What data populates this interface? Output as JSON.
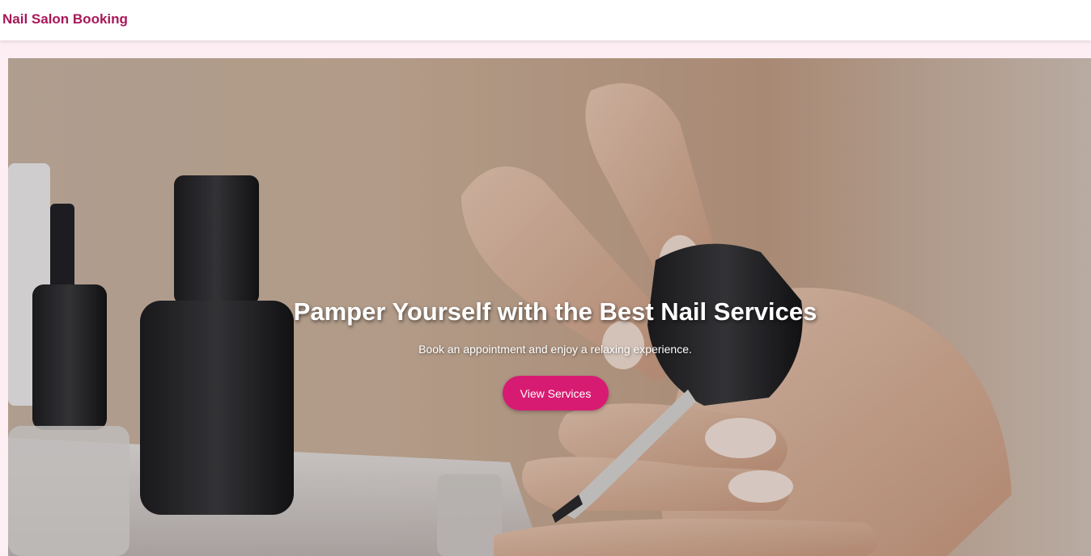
{
  "header": {
    "brand": "Nail Salon Booking"
  },
  "hero": {
    "title": "Pamper Yourself with the Best Nail Services",
    "subtitle": "Book an appointment and enjoy a relaxing experience.",
    "cta_label": "View Services",
    "image_subject": "hand-painting-nails-with-black-polish"
  },
  "colors": {
    "brand": "#a8175a",
    "accent": "#d81b72",
    "page_background": "#fdeef4",
    "header_background": "#ffffff"
  }
}
